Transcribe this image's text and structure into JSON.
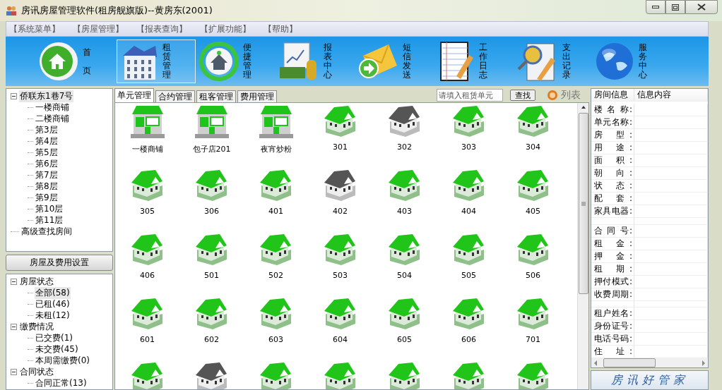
{
  "window": {
    "title": "房讯房屋管理软件(租房舰旗版)--黄房东(2001)"
  },
  "menu": [
    "【系统菜单】",
    "【房屋管理】",
    "【报表查询】",
    "【扩展功能】",
    "【帮助】"
  ],
  "toolbar": [
    {
      "label": "首页",
      "kind": "home",
      "selected": false
    },
    {
      "label": "租赁管理",
      "kind": "building",
      "selected": true
    },
    {
      "label": "便捷管理",
      "kind": "recycle",
      "selected": false
    },
    {
      "label": "报表中心",
      "kind": "report",
      "selected": false
    },
    {
      "label": "短信发送",
      "kind": "mail",
      "selected": false
    },
    {
      "label": "工作日志",
      "kind": "notebook",
      "selected": false
    },
    {
      "label": "支出记录",
      "kind": "expense",
      "selected": false
    },
    {
      "label": "服务中心",
      "kind": "globe",
      "selected": false
    }
  ],
  "building_tree": [
    {
      "label": "侨联东1巷7号",
      "expanded": true,
      "selected": true,
      "children": [
        {
          "label": "一楼商铺",
          "selected": false
        },
        {
          "label": "二楼商铺",
          "selected": false
        },
        {
          "label": "第3层",
          "selected": false
        },
        {
          "label": "第4层",
          "selected": false
        },
        {
          "label": "第5层",
          "selected": false
        },
        {
          "label": "第6层",
          "selected": false
        },
        {
          "label": "第7层",
          "selected": false
        },
        {
          "label": "第8层",
          "selected": false
        },
        {
          "label": "第9层",
          "selected": false
        },
        {
          "label": "第10层",
          "selected": false
        },
        {
          "label": "第11层",
          "selected": false
        }
      ]
    },
    {
      "label": "高级查找房间",
      "selected": false
    }
  ],
  "settings_button": "房屋及费用设置",
  "status_tree": [
    {
      "label": "房屋状态",
      "expanded": true,
      "selected": false,
      "children": [
        {
          "label": "全部(58)",
          "selected": true
        },
        {
          "label": "已租(46)",
          "selected": false
        },
        {
          "label": "未租(12)",
          "selected": false
        }
      ]
    },
    {
      "label": "缴费情况",
      "expanded": true,
      "selected": false,
      "children": [
        {
          "label": "已交费(1)",
          "selected": false
        },
        {
          "label": "未交费(45)",
          "selected": false
        },
        {
          "label": "本周需缴费(0)",
          "selected": false
        }
      ]
    },
    {
      "label": "合同状态",
      "expanded": true,
      "selected": false,
      "children": [
        {
          "label": "合同正常(13)",
          "selected": false
        }
      ]
    }
  ],
  "tabs": [
    {
      "label": "单元管理",
      "selected": true
    },
    {
      "label": "合约管理",
      "selected": false
    },
    {
      "label": "租客管理",
      "selected": false
    },
    {
      "label": "费用管理",
      "selected": false
    }
  ],
  "search": {
    "placeholder": "请填入租赁单元",
    "button": "查找"
  },
  "list_button": "列表",
  "units": [
    {
      "name": "一楼商铺",
      "kind": "shop",
      "rented": true
    },
    {
      "name": "包子店201",
      "kind": "shop",
      "rented": true
    },
    {
      "name": "夜宵炒粉",
      "kind": "shop",
      "rented": true
    },
    {
      "name": "301",
      "kind": "house",
      "rented": true
    },
    {
      "name": "302",
      "kind": "house",
      "rented": false
    },
    {
      "name": "303",
      "kind": "house",
      "rented": true
    },
    {
      "name": "304",
      "kind": "house",
      "rented": true
    },
    {
      "name": "305",
      "kind": "house",
      "rented": true
    },
    {
      "name": "306",
      "kind": "house",
      "rented": true
    },
    {
      "name": "401",
      "kind": "house",
      "rented": true
    },
    {
      "name": "402",
      "kind": "house",
      "rented": false
    },
    {
      "name": "403",
      "kind": "house",
      "rented": true
    },
    {
      "name": "404",
      "kind": "house",
      "rented": true
    },
    {
      "name": "405",
      "kind": "house",
      "rented": true
    },
    {
      "name": "406",
      "kind": "house",
      "rented": true
    },
    {
      "name": "501",
      "kind": "house",
      "rented": true
    },
    {
      "name": "502",
      "kind": "house",
      "rented": true
    },
    {
      "name": "503",
      "kind": "house",
      "rented": true
    },
    {
      "name": "504",
      "kind": "house",
      "rented": true
    },
    {
      "name": "505",
      "kind": "house",
      "rented": true
    },
    {
      "name": "506",
      "kind": "house",
      "rented": true
    },
    {
      "name": "601",
      "kind": "house",
      "rented": true
    },
    {
      "name": "602",
      "kind": "house",
      "rented": true
    },
    {
      "name": "603",
      "kind": "house",
      "rented": true
    },
    {
      "name": "604",
      "kind": "house",
      "rented": true
    },
    {
      "name": "605",
      "kind": "house",
      "rented": true
    },
    {
      "name": "606",
      "kind": "house",
      "rented": true
    },
    {
      "name": "701",
      "kind": "house",
      "rented": true
    },
    {
      "kind": "house",
      "rented": true
    },
    {
      "kind": "house",
      "rented": false
    },
    {
      "kind": "house",
      "rented": true
    },
    {
      "kind": "house",
      "rented": true
    },
    {
      "kind": "house",
      "rented": true
    },
    {
      "kind": "house",
      "rented": true
    },
    {
      "kind": "house",
      "rented": true
    }
  ],
  "info_table": {
    "columns": [
      "房间信息",
      "信息内容"
    ],
    "rows": [
      {
        "kind": "field",
        "label": "楼 名 称:"
      },
      {
        "kind": "field",
        "label": "单元名称:"
      },
      {
        "kind": "field",
        "label": "房 型:"
      },
      {
        "kind": "field",
        "label": "用 途:"
      },
      {
        "kind": "field",
        "label": "面 积:"
      },
      {
        "kind": "field",
        "label": "朝 向:"
      },
      {
        "kind": "field",
        "label": "状 态:"
      },
      {
        "kind": "field",
        "label": "配 套:"
      },
      {
        "kind": "field",
        "label": "家具电器:"
      },
      {
        "kind": "spacer"
      },
      {
        "kind": "field",
        "label": "合 同 号:"
      },
      {
        "kind": "field",
        "label": "租 金:"
      },
      {
        "kind": "field",
        "label": "押 金:"
      },
      {
        "kind": "field",
        "label": "租 期:"
      },
      {
        "kind": "field",
        "label": "押付模式:"
      },
      {
        "kind": "field",
        "label": "收费周期:"
      },
      {
        "kind": "spacer"
      },
      {
        "kind": "field",
        "label": "租户姓名:"
      },
      {
        "kind": "field",
        "label": "身份证号:"
      },
      {
        "kind": "field",
        "label": "电话号码:"
      },
      {
        "kind": "field",
        "label": "住 址:"
      }
    ]
  },
  "brand_banner": "房讯好管家"
}
